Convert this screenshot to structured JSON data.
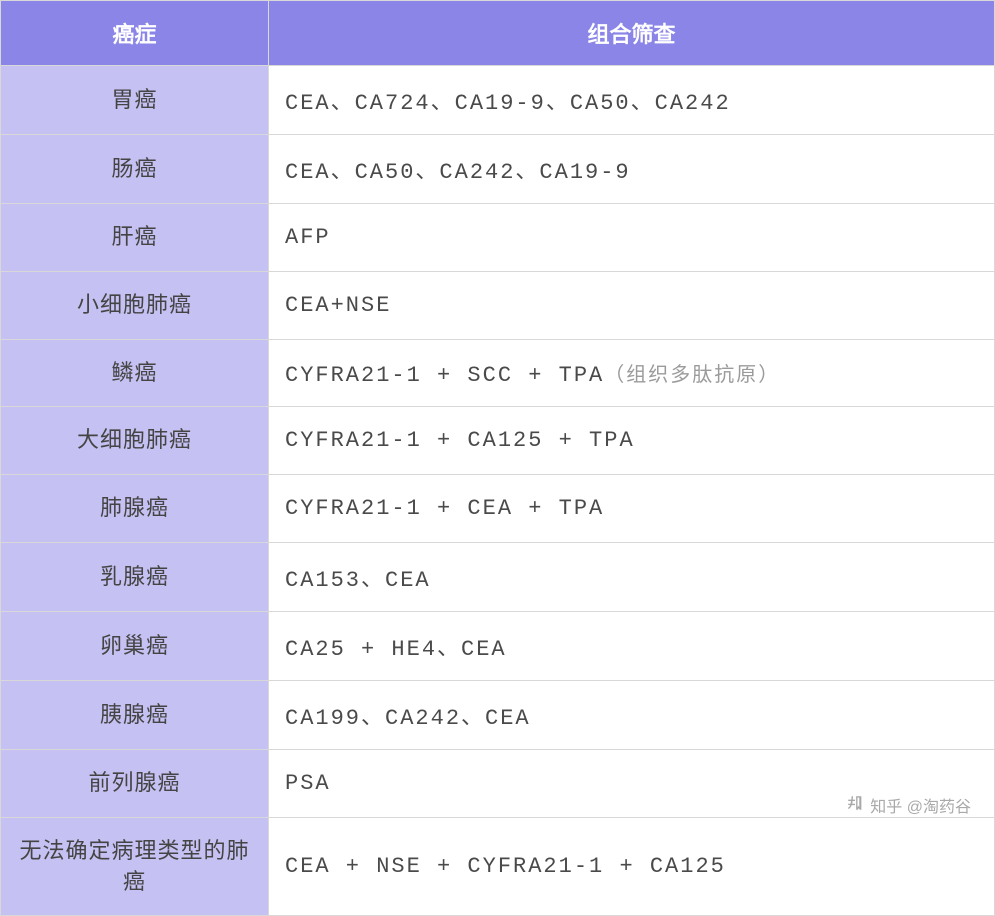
{
  "headers": {
    "cancer": "癌症",
    "screening": "组合筛查"
  },
  "rows": [
    {
      "cancer": "胃癌",
      "screening": "CEA、CA724、CA19-9、CA50、CA242",
      "note": ""
    },
    {
      "cancer": "肠癌",
      "screening": "CEA、CA50、CA242、CA19-9",
      "note": ""
    },
    {
      "cancer": "肝癌",
      "screening": "AFP",
      "note": ""
    },
    {
      "cancer": "小细胞肺癌",
      "screening": "CEA+NSE",
      "note": ""
    },
    {
      "cancer": "鳞癌",
      "screening": "CYFRA21-1 + SCC + TPA",
      "note": "（组织多肽抗原）"
    },
    {
      "cancer": "大细胞肺癌",
      "screening": "CYFRA21-1 + CA125 + TPA",
      "note": ""
    },
    {
      "cancer": "肺腺癌",
      "screening": "CYFRA21-1 + CEA + TPA",
      "note": ""
    },
    {
      "cancer": "乳腺癌",
      "screening": "CA153、CEA",
      "note": ""
    },
    {
      "cancer": "卵巢癌",
      "screening": "CA25 + HE4、CEA",
      "note": ""
    },
    {
      "cancer": "胰腺癌",
      "screening": "CA199、CA242、CEA",
      "note": ""
    },
    {
      "cancer": "前列腺癌",
      "screening": "PSA",
      "note": ""
    },
    {
      "cancer": "无法确定病理类型的肺癌",
      "screening": "CEA + NSE + CYFRA21-1 + CA125",
      "note": ""
    }
  ],
  "watermark": "知乎 @淘药谷"
}
